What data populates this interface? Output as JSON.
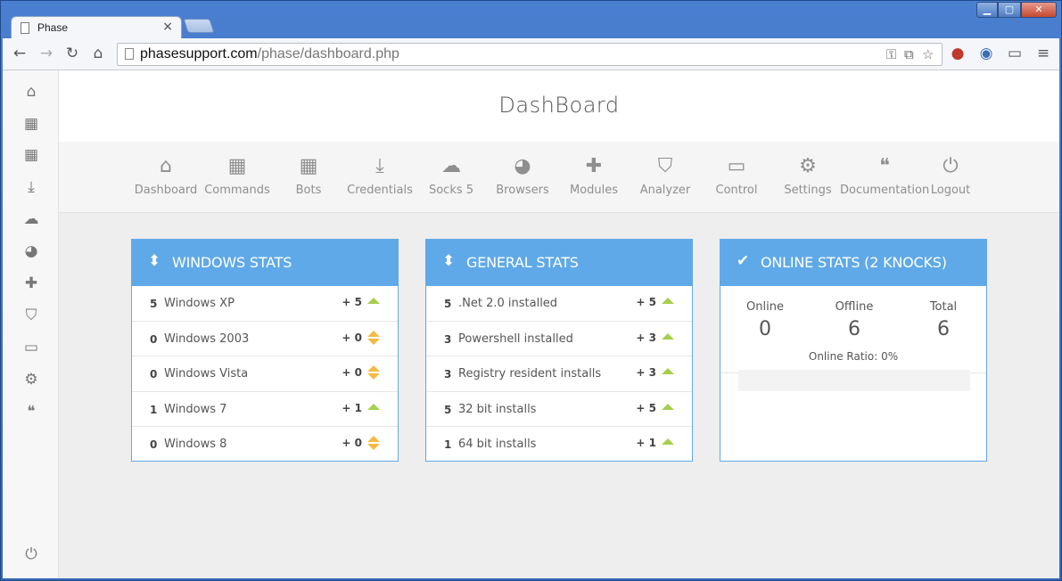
{
  "browser": {
    "tab_title": "Phase",
    "url_host": "phasesupport.com",
    "url_path": "/phase/dashboard.php"
  },
  "header": {
    "title": "DashBoard"
  },
  "nav": [
    {
      "label": "Dashboard",
      "icon": "home-icon",
      "glyph": "⌂"
    },
    {
      "label": "Commands",
      "icon": "calendar-icon",
      "glyph": "▦"
    },
    {
      "label": "Bots",
      "icon": "table-icon",
      "glyph": "▦"
    },
    {
      "label": "Credentials",
      "icon": "download-icon",
      "glyph": "⤓"
    },
    {
      "label": "Socks 5",
      "icon": "cloud-icon",
      "glyph": "☁"
    },
    {
      "label": "Browsers",
      "icon": "globe-icon",
      "glyph": "◕"
    },
    {
      "label": "Modules",
      "icon": "puzzle-icon",
      "glyph": "✚"
    },
    {
      "label": "Analyzer",
      "icon": "shield-icon",
      "glyph": "⛉"
    },
    {
      "label": "Control",
      "icon": "monitor-icon",
      "glyph": "▭"
    },
    {
      "label": "Settings",
      "icon": "gears-icon",
      "glyph": "⚙"
    },
    {
      "label": "Documentation",
      "icon": "comments-icon",
      "glyph": "❝"
    },
    {
      "label": "Logout",
      "icon": "power-icon",
      "glyph": "⏻"
    }
  ],
  "windows_stats": {
    "title": "WINDOWS STATS",
    "rows": [
      {
        "count": "5",
        "label": "Windows XP",
        "delta": "+ 5",
        "trend": "up"
      },
      {
        "count": "0",
        "label": "Windows 2003",
        "delta": "+ 0",
        "trend": "neutral"
      },
      {
        "count": "0",
        "label": "Windows Vista",
        "delta": "+ 0",
        "trend": "neutral"
      },
      {
        "count": "1",
        "label": "Windows 7",
        "delta": "+ 1",
        "trend": "up"
      },
      {
        "count": "0",
        "label": "Windows 8",
        "delta": "+ 0",
        "trend": "neutral"
      }
    ]
  },
  "general_stats": {
    "title": "GENERAL STATS",
    "rows": [
      {
        "count": "5",
        "label": ".Net 2.0 installed",
        "delta": "+ 5",
        "trend": "up"
      },
      {
        "count": "3",
        "label": "Powershell installed",
        "delta": "+ 3",
        "trend": "up"
      },
      {
        "count": "3",
        "label": "Registry resident installs",
        "delta": "+ 3",
        "trend": "up"
      },
      {
        "count": "5",
        "label": "32 bit installs",
        "delta": "+ 5",
        "trend": "up"
      },
      {
        "count": "1",
        "label": "64 bit installs",
        "delta": "+ 1",
        "trend": "up"
      }
    ]
  },
  "online_stats": {
    "title": "ONLINE STATS (2 KNOCKS)",
    "online_label": "Online",
    "online_value": "0",
    "offline_label": "Offline",
    "offline_value": "6",
    "total_label": "Total",
    "total_value": "6",
    "ratio_label": "Online Ratio: 0%",
    "ratio_percent": 0
  },
  "colors": {
    "accent": "#5fa9e8",
    "up": "#a7cf4d",
    "neutral": "#f3bb44"
  }
}
